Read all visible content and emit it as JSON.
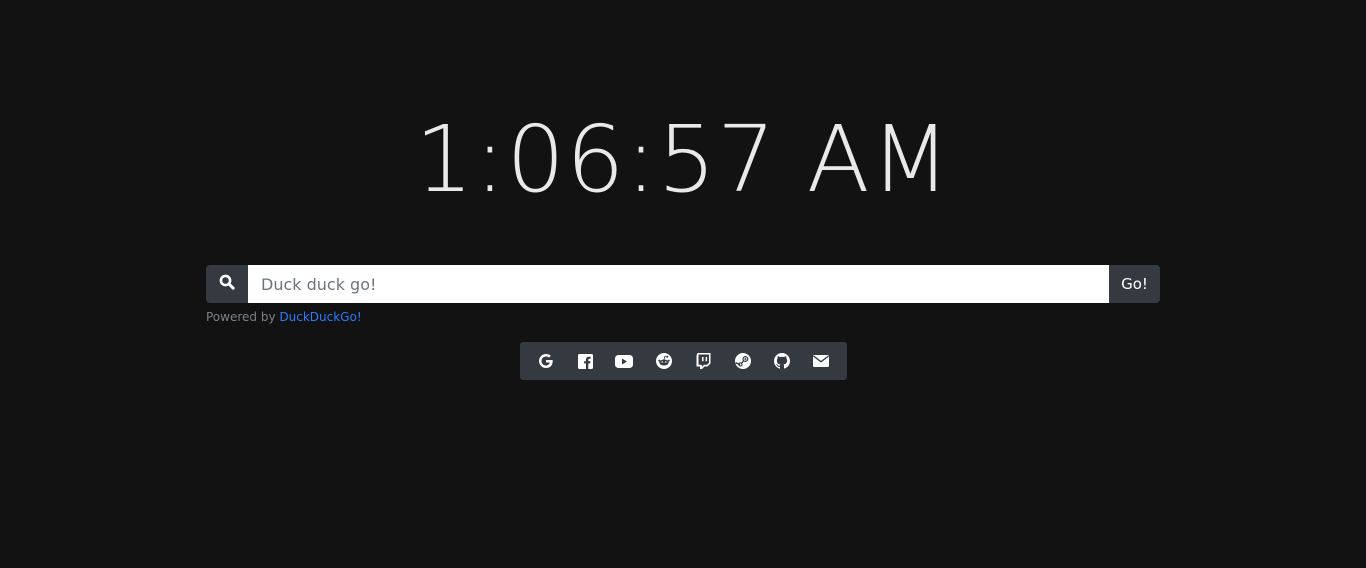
{
  "clock": {
    "time": "1:06:57 AM"
  },
  "search": {
    "placeholder": "Duck duck go!",
    "value": "",
    "go_label": "Go!",
    "icon": "search-icon"
  },
  "powered_by": {
    "prefix": "Powered by",
    "link_text": "DuckDuckGo!"
  },
  "shortcuts": [
    {
      "name": "google",
      "icon": "google-icon"
    },
    {
      "name": "facebook",
      "icon": "facebook-icon"
    },
    {
      "name": "youtube",
      "icon": "youtube-icon"
    },
    {
      "name": "reddit",
      "icon": "reddit-icon"
    },
    {
      "name": "twitch",
      "icon": "twitch-icon"
    },
    {
      "name": "steam",
      "icon": "steam-icon"
    },
    {
      "name": "github",
      "icon": "github-icon"
    },
    {
      "name": "email",
      "icon": "envelope-icon"
    }
  ],
  "colors": {
    "background": "#121212",
    "panel": "#343a40",
    "link": "#2a7bff",
    "clock_text": "#e9e9e9"
  }
}
